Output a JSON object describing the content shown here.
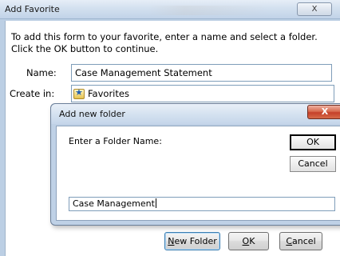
{
  "outer_dialog": {
    "title": "Add Favorite",
    "close_glyph": "X",
    "instructions": "To add this form to your favorite, enter a name and select a folder. Click the OK button to continue.",
    "name_label": "Name:",
    "name_value": "Case Management Statement",
    "create_in_label": "Create in:",
    "create_in_value": "Favorites",
    "buttons": {
      "new_folder": {
        "label_u": "N",
        "label_rest": "ew Folder"
      },
      "ok": {
        "label_u": "O",
        "label_rest": "K"
      },
      "cancel": {
        "label_u": "C",
        "label_rest": "ancel"
      }
    }
  },
  "inner_dialog": {
    "title": "Add new folder",
    "close_glyph": "X",
    "prompt": "Enter a Folder Name:",
    "ok_label": "OK",
    "cancel_label": "Cancel",
    "folder_name_value": "Case Management"
  }
}
